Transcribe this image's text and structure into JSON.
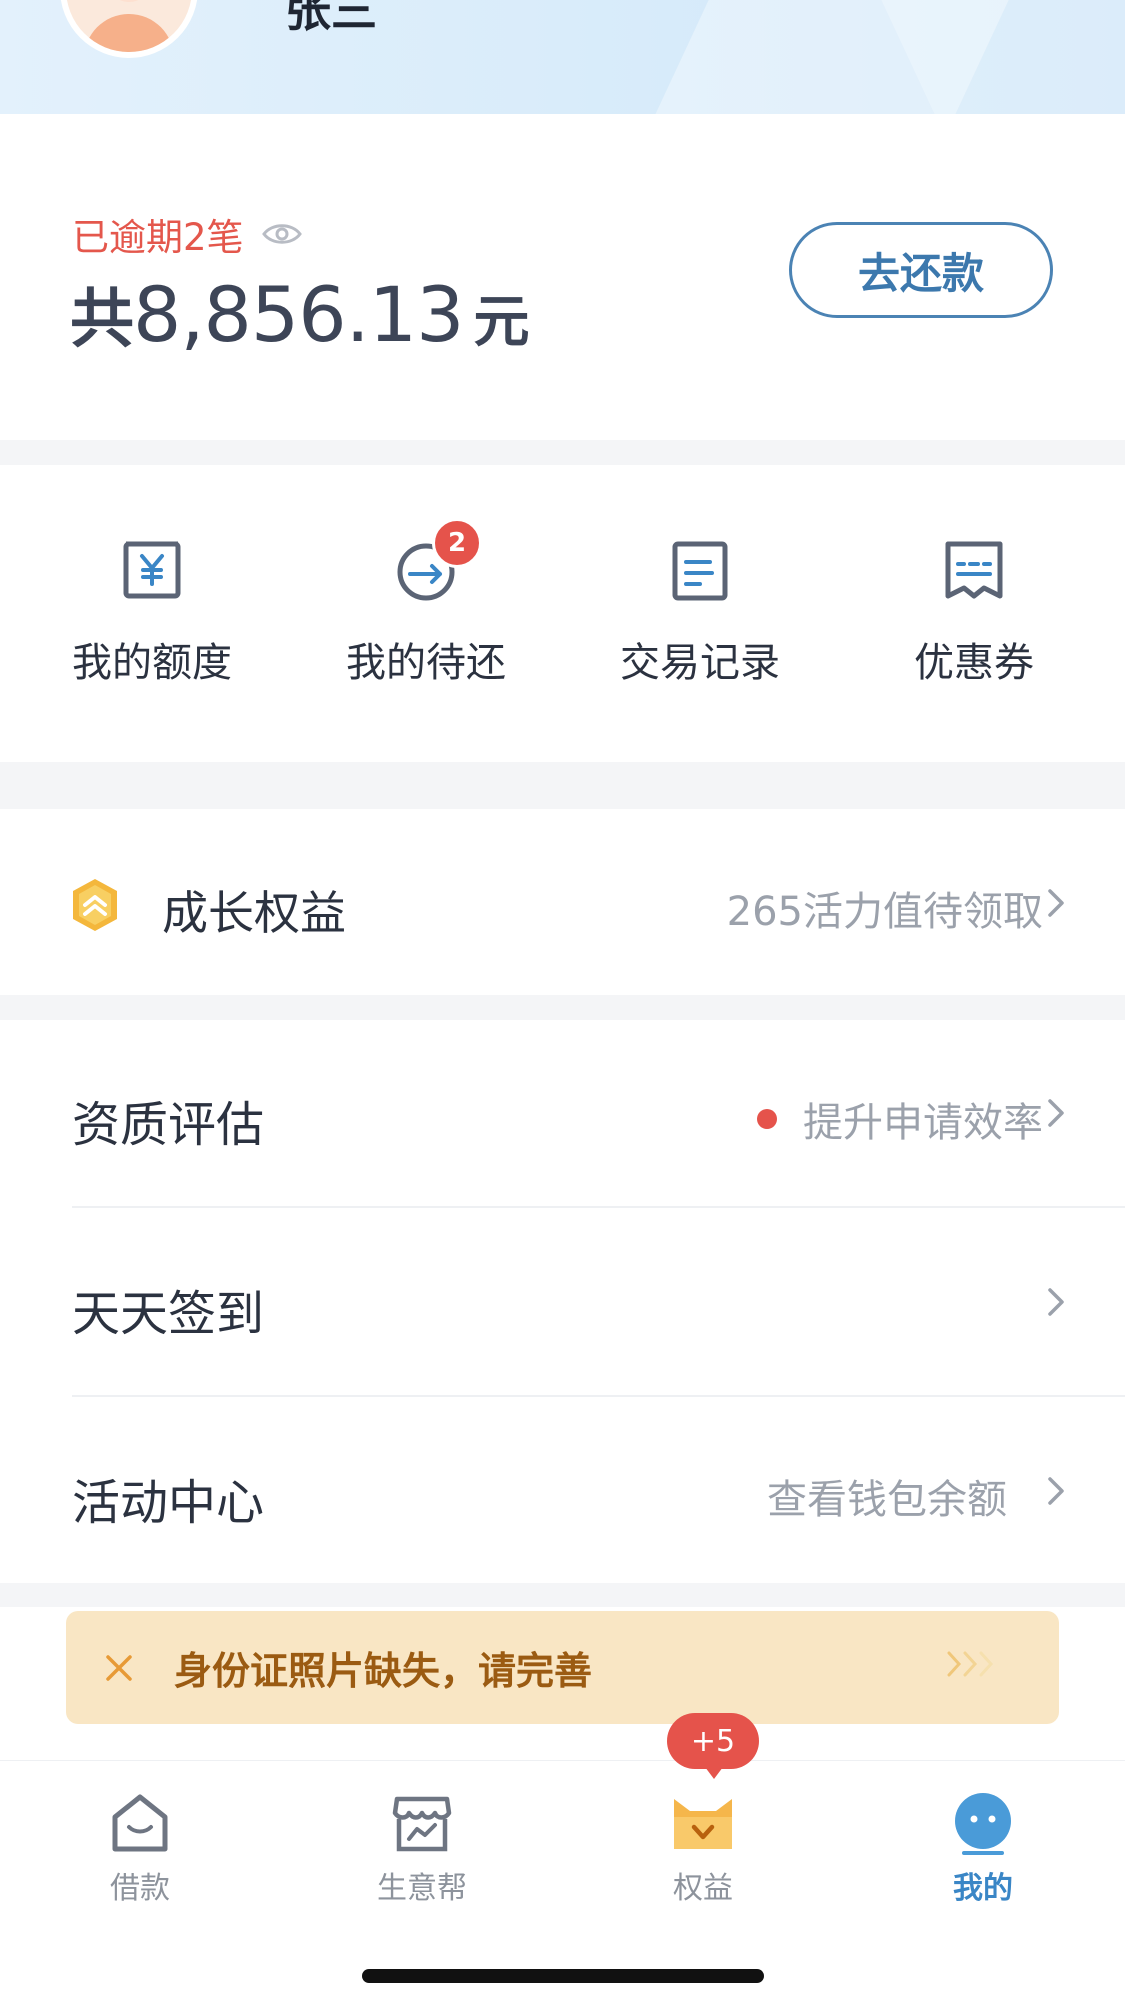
{
  "header": {
    "username": "张三"
  },
  "repayment": {
    "overdue_label": "已逾期2笔",
    "amount_prefix": "共",
    "amount": "8,856.13",
    "amount_unit": "元",
    "repay_button": "去还款"
  },
  "quick_actions": [
    {
      "label": "我的额度",
      "icon": "credit-limit-icon"
    },
    {
      "label": "我的待还",
      "icon": "pending-repay-icon",
      "badge": "2"
    },
    {
      "label": "交易记录",
      "icon": "transaction-record-icon"
    },
    {
      "label": "优惠券",
      "icon": "coupon-icon"
    }
  ],
  "growth": {
    "title": "成长权益",
    "detail": "265活力值待领取"
  },
  "menu": [
    {
      "title": "资质评估",
      "detail": "提升申请效率",
      "dot": true
    },
    {
      "title": "天天签到",
      "detail": ""
    },
    {
      "title": "活动中心",
      "detail": "查看钱包余额"
    }
  ],
  "notice": {
    "text": "身份证照片缺失，请完善"
  },
  "tabbar": {
    "items": [
      {
        "label": "借款",
        "icon": "loan-icon"
      },
      {
        "label": "生意帮",
        "icon": "business-icon"
      },
      {
        "label": "权益",
        "icon": "benefits-icon"
      },
      {
        "label": "我的",
        "icon": "profile-icon",
        "active": true
      }
    ],
    "benefits_bubble": "+5"
  },
  "colors": {
    "accent": "#3a86c6",
    "alert": "#e5534b",
    "notice_bg": "#f9e6c4",
    "notice_text": "#9b5b12"
  }
}
